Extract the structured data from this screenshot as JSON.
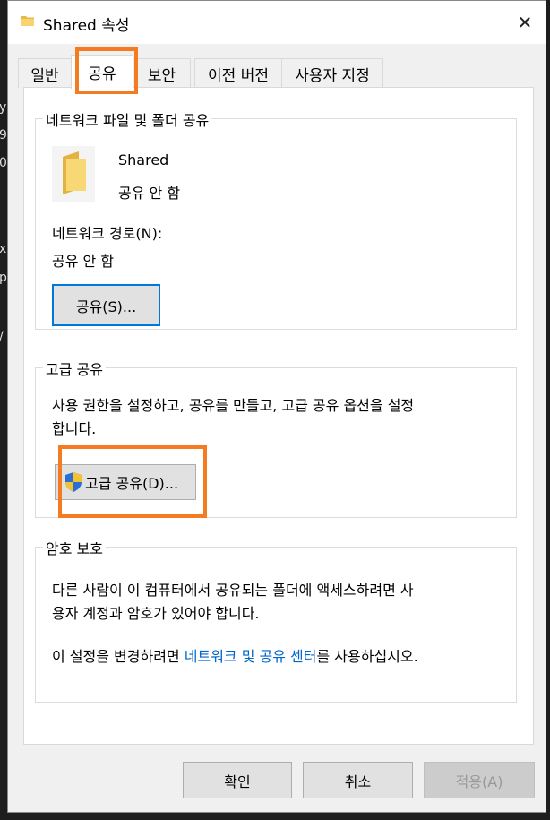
{
  "background_fragments": [
    "y",
    "9",
    "0",
    "x",
    "p",
    "/"
  ],
  "dialog": {
    "title": "Shared 속성",
    "close_glyph": "✕"
  },
  "tabs": [
    {
      "label": "일반"
    },
    {
      "label": "공유"
    },
    {
      "label": "보안"
    },
    {
      "label": "이전 버전"
    },
    {
      "label": "사용자 지정"
    }
  ],
  "network_sharing": {
    "group_title": "네트워크 파일 및 폴더 공유",
    "folder_name": "Shared",
    "folder_status": "공유 안 함",
    "path_label": "네트워크 경로(N):",
    "path_value": "공유 안 함",
    "share_button": "공유(S)..."
  },
  "advanced_sharing": {
    "group_title": "고급 공유",
    "description_line1": "사용 권한을 설정하고, 공유를 만들고, 고급 공유 옵션을 설정",
    "description_line2": "합니다.",
    "button": "고급 공유(D)..."
  },
  "password_protection": {
    "group_title": "암호 보호",
    "line1": "다른 사람이 이 컴퓨터에서 공유되는 폴더에 액세스하려면 사",
    "line2": "용자 계정과 암호가 있어야 합니다.",
    "line3_prefix": "이 설정을 변경하려면 ",
    "line3_link": "네트워크 및 공유 센터",
    "line3_suffix": "를 사용하십시오."
  },
  "footer": {
    "ok": "확인",
    "cancel": "취소",
    "apply": "적용(A)"
  },
  "colors": {
    "highlight": "#f47b20",
    "link": "#0066cc",
    "focus": "#0078d7"
  }
}
